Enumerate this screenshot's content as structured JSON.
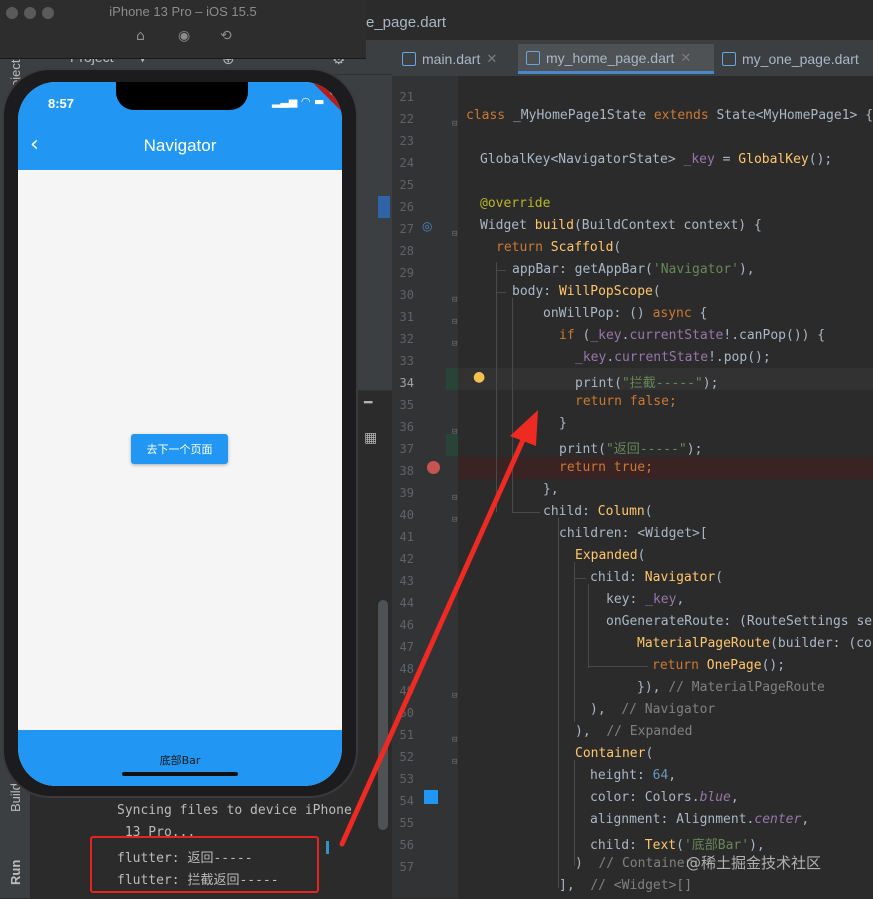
{
  "simulator": {
    "title": "iPhone 13 Pro – iOS 15.5",
    "icons": [
      "home-icon",
      "screenshot-icon",
      "rotate-icon"
    ],
    "status_time": "8:57",
    "status_icons": "▂▃▅ ◠ ▬",
    "debug_banner": "DEBUG",
    "app_title": "Navigator",
    "back_glyph": "‹",
    "next_button": "去下一个页面",
    "bottom_bar_label": "底部Bar",
    "colors": {
      "primary": "#2196f3",
      "debug": "#b71c1c"
    }
  },
  "ide": {
    "partial_tab": "e_page.dart",
    "project_label": "Project",
    "tabs": [
      {
        "label": "main.dart",
        "active": false
      },
      {
        "label": "my_home_page.dart",
        "active": true
      },
      {
        "label": "my_one_page.dart",
        "active": false
      }
    ],
    "side_labels": {
      "project": "Project",
      "build": "Build",
      "run": "Run"
    },
    "line_numbers": [
      "21",
      "22",
      "23",
      "24",
      "25",
      "26",
      "27",
      "28",
      "29",
      "30",
      "31",
      "32",
      "33",
      "34",
      "35",
      "36",
      "37",
      "38",
      "39",
      "40",
      "41",
      "42",
      "43",
      "44",
      "46",
      "47",
      "48",
      "49",
      "50",
      "51",
      "52",
      "53",
      "54",
      "55",
      "56",
      "57"
    ],
    "current_line": "34",
    "console": {
      "line1": "Syncing files to device iPhone",
      "line2": " 13 Pro...",
      "line3": "flutter: 返回-----",
      "line4": "flutter: 拦截返回-----"
    }
  },
  "code": {
    "l22": {
      "a": "class ",
      "b": "_MyHomePage1State ",
      "c": "extends ",
      "d": "State<MyHomePage1> {"
    },
    "l24": {
      "a": "GlobalKey<NavigatorState> ",
      "b": "_key",
      "c": " = ",
      "d": "GlobalKey",
      "e": "();"
    },
    "l26": {
      "a": "@override"
    },
    "l27": {
      "a": "Widget ",
      "b": "build",
      "c": "(BuildContext context) {"
    },
    "l28": {
      "a": "return ",
      "b": "Scaffold",
      "c": "("
    },
    "l29": {
      "a": "appBar: getAppBar(",
      "b": "'Navigator'",
      "c": "),"
    },
    "l30": {
      "a": "body: ",
      "b": "WillPopScope",
      "c": "("
    },
    "l31": {
      "a": "onWillPop: () ",
      "b": "async",
      "c": " {"
    },
    "l32": {
      "a": "if ",
      "b": "(",
      "c": "_key",
      "d": ".",
      "e": "currentState",
      "f": "!.canPop()) {"
    },
    "l33": {
      "a": "_key",
      "b": ".",
      "c": "currentState",
      "d": "!.pop();"
    },
    "l34": {
      "a": "print",
      "b": "(",
      "c": "\"拦截-----\"",
      "d": ");"
    },
    "l35": {
      "a": "return ",
      "b": "false",
      "c": ";"
    },
    "l36": {
      "a": "}"
    },
    "l37": {
      "a": "print",
      "b": "(",
      "c": "\"返回-----\"",
      "d": ");"
    },
    "l38": {
      "a": "return ",
      "b": "true",
      "c": ";"
    },
    "l39": {
      "a": "},"
    },
    "l40": {
      "a": "child: ",
      "b": "Column",
      "c": "("
    },
    "l41": {
      "a": "children: <Widget>["
    },
    "l42": {
      "a": "Expanded",
      "b": "("
    },
    "l43": {
      "a": "child: ",
      "b": "Navigator",
      "c": "("
    },
    "l44": {
      "a": "key: ",
      "b": "_key",
      "c": ","
    },
    "l46": {
      "a": "onGenerateRoute: (RouteSettings set"
    },
    "l47": {
      "a": "MaterialPageRoute",
      "b": "(builder: (con"
    },
    "l48": {
      "a": "return ",
      "b": "OnePage",
      "c": "();"
    },
    "l49": {
      "a": "}), ",
      "b": "// MaterialPageRoute"
    },
    "l50": {
      "a": "),  ",
      "b": "// Navigator"
    },
    "l51": {
      "a": "),  ",
      "b": "// Expanded"
    },
    "l52": {
      "a": "Container",
      "b": "("
    },
    "l53": {
      "a": "height: ",
      "b": "64",
      "c": ","
    },
    "l54": {
      "a": "color: Colors.",
      "b": "blue",
      "c": ","
    },
    "l55": {
      "a": "alignment: Alignment.",
      "b": "center",
      "c": ","
    },
    "l56": {
      "a": "child: ",
      "b": "Text",
      "c": "(",
      "d": "'底部Bar'",
      "e": "),"
    },
    "l57": {
      "a": ")  ",
      "b": "// Container"
    },
    "l58": {
      "a": "],  ",
      "b": "// <Widget>[]"
    }
  },
  "watermark": "@稀土掘金技术社区"
}
